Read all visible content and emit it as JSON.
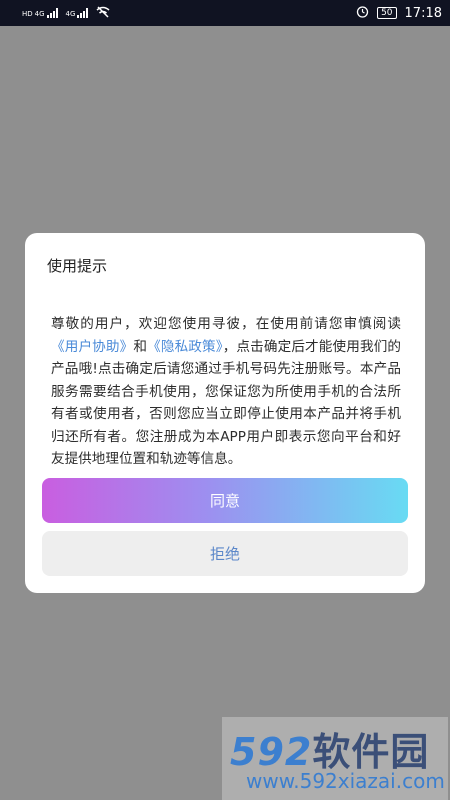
{
  "status_bar": {
    "sim1_label": "HD",
    "sim1_net": "4G",
    "sim2_net": "4G",
    "battery": "50",
    "time": "17:18",
    "icons": [
      "hd-icon",
      "signal-icon",
      "wifi-off-icon",
      "alarm-icon",
      "battery-icon"
    ]
  },
  "dialog": {
    "title": "使用提示",
    "body": {
      "part1": "尊敬的用户，欢迎您使用寻彼，在使用前请您审慎阅读",
      "link_user_help": "《用户协助》",
      "part2": "和",
      "link_privacy": "《隐私政策》",
      "part3": "，点击确定后才能使用我们的产品哦!点击确定后请您通过手机号码先注册账号。本产品服务需要结合手机使用，您保证您为所使用手机的合法所有者或使用者，否则您应当立即停止使用本产品并将手机归还所有者。您注册成为本APP用户即表示您向平台和好友提供地理位置和轨迹等信息。"
    },
    "agree_label": "同意",
    "reject_label": "拒绝"
  },
  "watermark": {
    "logo_num": "592",
    "logo_text": "软件园",
    "url": "www.592xiazai.com"
  }
}
